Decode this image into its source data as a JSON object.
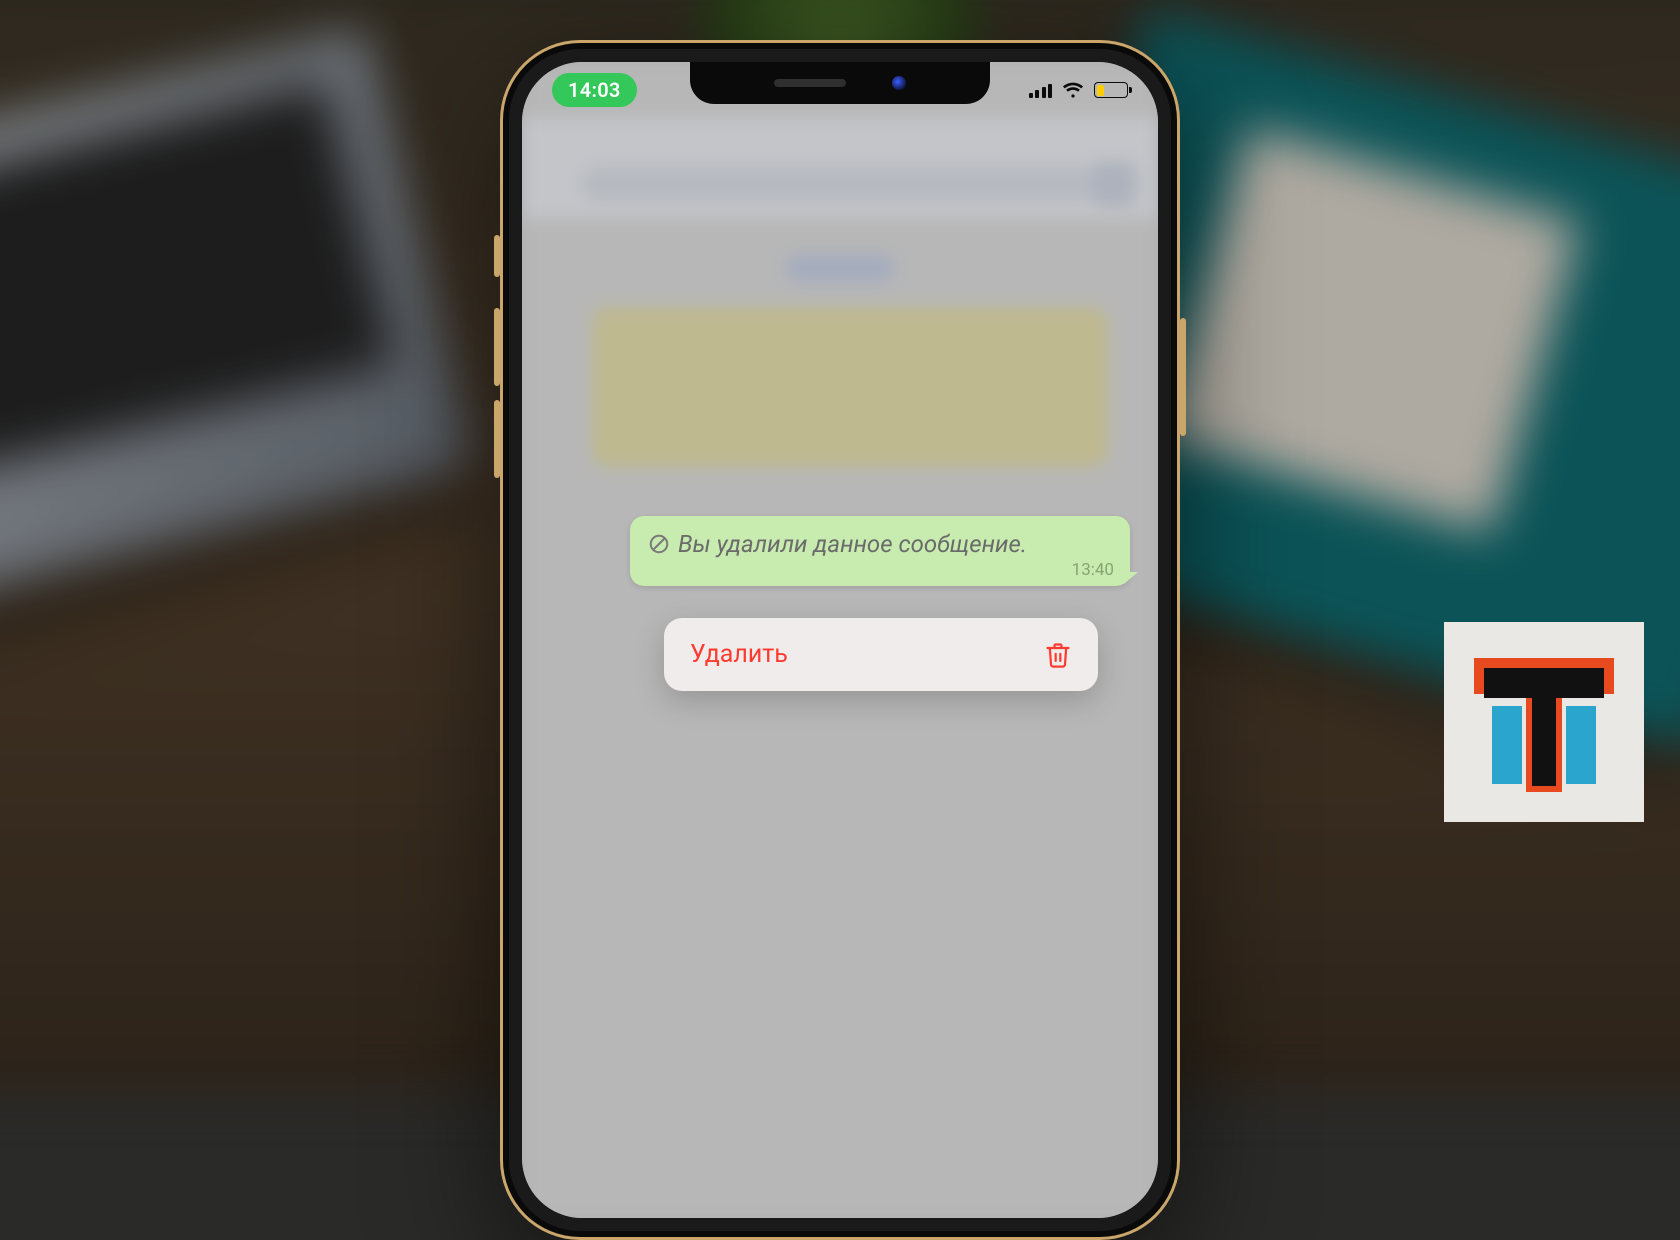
{
  "statusbar": {
    "time": "14:03"
  },
  "message": {
    "deleted_text": "Вы удалили данное сообщение.",
    "timestamp": "13:40"
  },
  "context_menu": {
    "delete_label": "Удалить"
  },
  "logo": {
    "letter": "T"
  }
}
